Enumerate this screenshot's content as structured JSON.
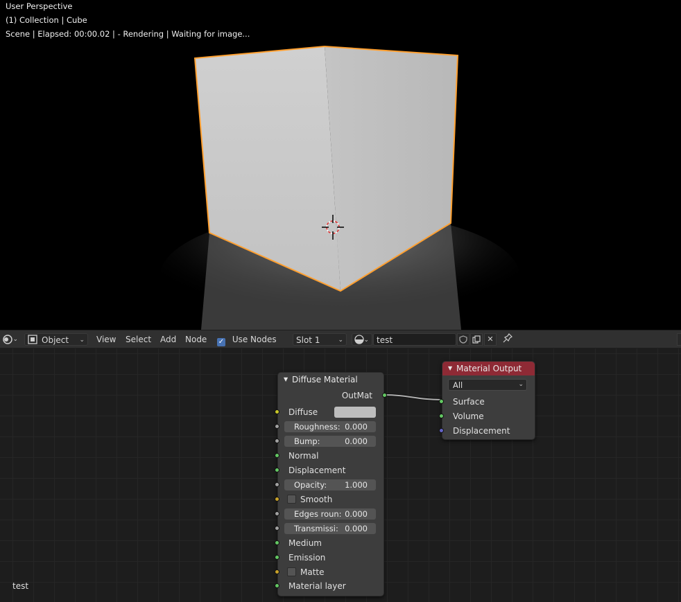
{
  "viewport": {
    "overlay_lines": [
      "User Perspective",
      "(1) Collection | Cube",
      "Scene | Elapsed: 00:00.02 |  - Rendering | Waiting for image..."
    ],
    "object_color": "#c9c9c9",
    "selection_outline_color": "#ffa030"
  },
  "header": {
    "editor_type_icon": "node-editor-icon",
    "object_mode_icon": "object-icon",
    "shader_type": "Object",
    "menus": [
      "View",
      "Select",
      "Add",
      "Node"
    ],
    "use_nodes_label": "Use Nodes",
    "use_nodes_checked": true,
    "slot": "Slot 1",
    "material_icon": "material-sphere-icon",
    "material_name": "test",
    "fake_user_icon": "shield-icon",
    "duplicate_icon": "duplicate-icon",
    "unlink_icon": "close-icon",
    "pin_icon": "pin-icon"
  },
  "node_editor": {
    "material_label": "test",
    "diffuse_node": {
      "title": "Diffuse Material",
      "output": "OutMat",
      "diffuse_label": "Diffuse",
      "diffuse_color": "#bdbdbd",
      "roughness_label": "Roughness:",
      "roughness_value": "0.000",
      "bump_label": "Bump:",
      "bump_value": "0.000",
      "normal_label": "Normal",
      "displacement_label": "Displacement",
      "opacity_label": "Opacity:",
      "opacity_value": "1.000",
      "smooth_label": "Smooth",
      "edges_label": "Edges roun:",
      "edges_value": "0.000",
      "transmission_label": "Transmissi:",
      "transmission_value": "0.000",
      "medium_label": "Medium",
      "emission_label": "Emission",
      "matte_label": "Matte",
      "material_layer_label": "Material layer"
    },
    "output_node": {
      "title": "Material Output",
      "title_color": "#8e2a35",
      "target": "All",
      "surface_label": "Surface",
      "volume_label": "Volume",
      "displacement_label": "Displacement"
    },
    "socket_colors": {
      "shader": "#63c763",
      "color": "#c7c729",
      "float": "#a1a1a1",
      "vector": "#6363c7"
    }
  }
}
